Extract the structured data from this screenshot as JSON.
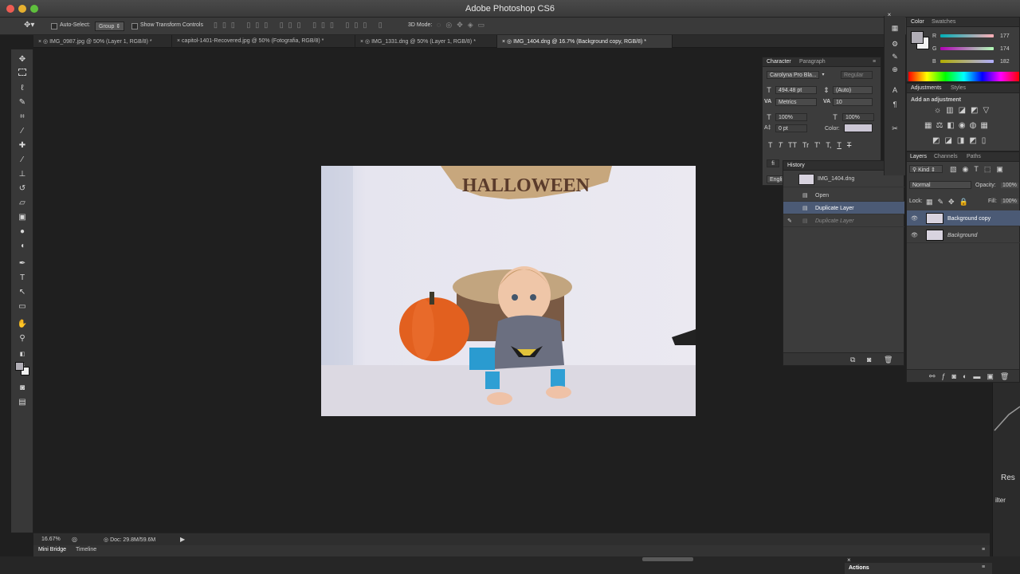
{
  "window": {
    "title": "Adobe Photoshop CS6"
  },
  "options_bar": {
    "auto_select_label": "Auto-Select:",
    "auto_select_value": "Group",
    "show_transform_label": "Show Transform Controls",
    "mode_3d_label": "3D Mode:"
  },
  "doc_tabs": [
    {
      "label": "IMG_0987.jpg @ 50% (Layer 1, RGB/8) *"
    },
    {
      "label": "capitol-1401-Recovered.jpg @ 50% (Fotografia, RGB/8) *"
    },
    {
      "label": "IMG_1331.dng @ 50% (Layer 1, RGB/8) *"
    },
    {
      "label": "IMG_1404.dng @ 16.7% (Background copy, RGB/8) *"
    }
  ],
  "tab_close_glyph": "×",
  "photo": {
    "banner_text": "HALLOWEEN"
  },
  "status": {
    "zoom": "16.67%",
    "doc_info": "Doc: 29.8M/59.6M"
  },
  "bottom_tabs": {
    "mini_bridge": "Mini Bridge",
    "timeline": "Timeline"
  },
  "actions_label": "Actions",
  "character_panel": {
    "tab_character": "Character",
    "tab_paragraph": "Paragraph",
    "font_family": "Carolyna Pro Bla...",
    "font_style": "Regular",
    "font_size": "494.48 pt",
    "leading": "(Auto)",
    "kerning": "Metrics",
    "tracking": "10",
    "vertical_scale": "100%",
    "horizontal_scale": "100%",
    "baseline_shift": "0 pt",
    "color_label": "Color:",
    "style_buttons": [
      "T",
      "T",
      "TT",
      "Tr",
      "T'",
      "T,",
      "T",
      "T"
    ],
    "language": "Engli",
    "fi_glyph": "fi"
  },
  "history_panel": {
    "tab": "History",
    "snapshot": "IMG_1404.dng",
    "items": [
      "Open",
      "Duplicate Layer",
      "Duplicate Layer"
    ]
  },
  "color_panel": {
    "tab_color": "Color",
    "tab_swatches": "Swatches",
    "r_label": "R",
    "r_value": "177",
    "g_label": "G",
    "g_value": "174",
    "b_label": "B",
    "b_value": "182",
    "r": 177,
    "g": 174,
    "b": 182
  },
  "adjustments_panel": {
    "tab_adjustments": "Adjustments",
    "tab_styles": "Styles",
    "hint": "Add an adjustment"
  },
  "layers_panel": {
    "tab_layers": "Layers",
    "tab_channels": "Channels",
    "tab_paths": "Paths",
    "kind_label": "Kind",
    "blend_mode": "Normal",
    "opacity_label": "Opacity:",
    "opacity_value": "100%",
    "lock_label": "Lock:",
    "fill_label": "Fill:",
    "fill_value": "100%",
    "layers": [
      {
        "name": "Background copy",
        "selected": true
      },
      {
        "name": "Background",
        "selected": false
      }
    ]
  },
  "edge_labels": {
    "res": "Res",
    "filter": "ilter"
  },
  "colors": {
    "accent_selected": "#4b5a75",
    "foreground_swatch": "#b1aeb6",
    "pumpkin": "#e2601f"
  }
}
